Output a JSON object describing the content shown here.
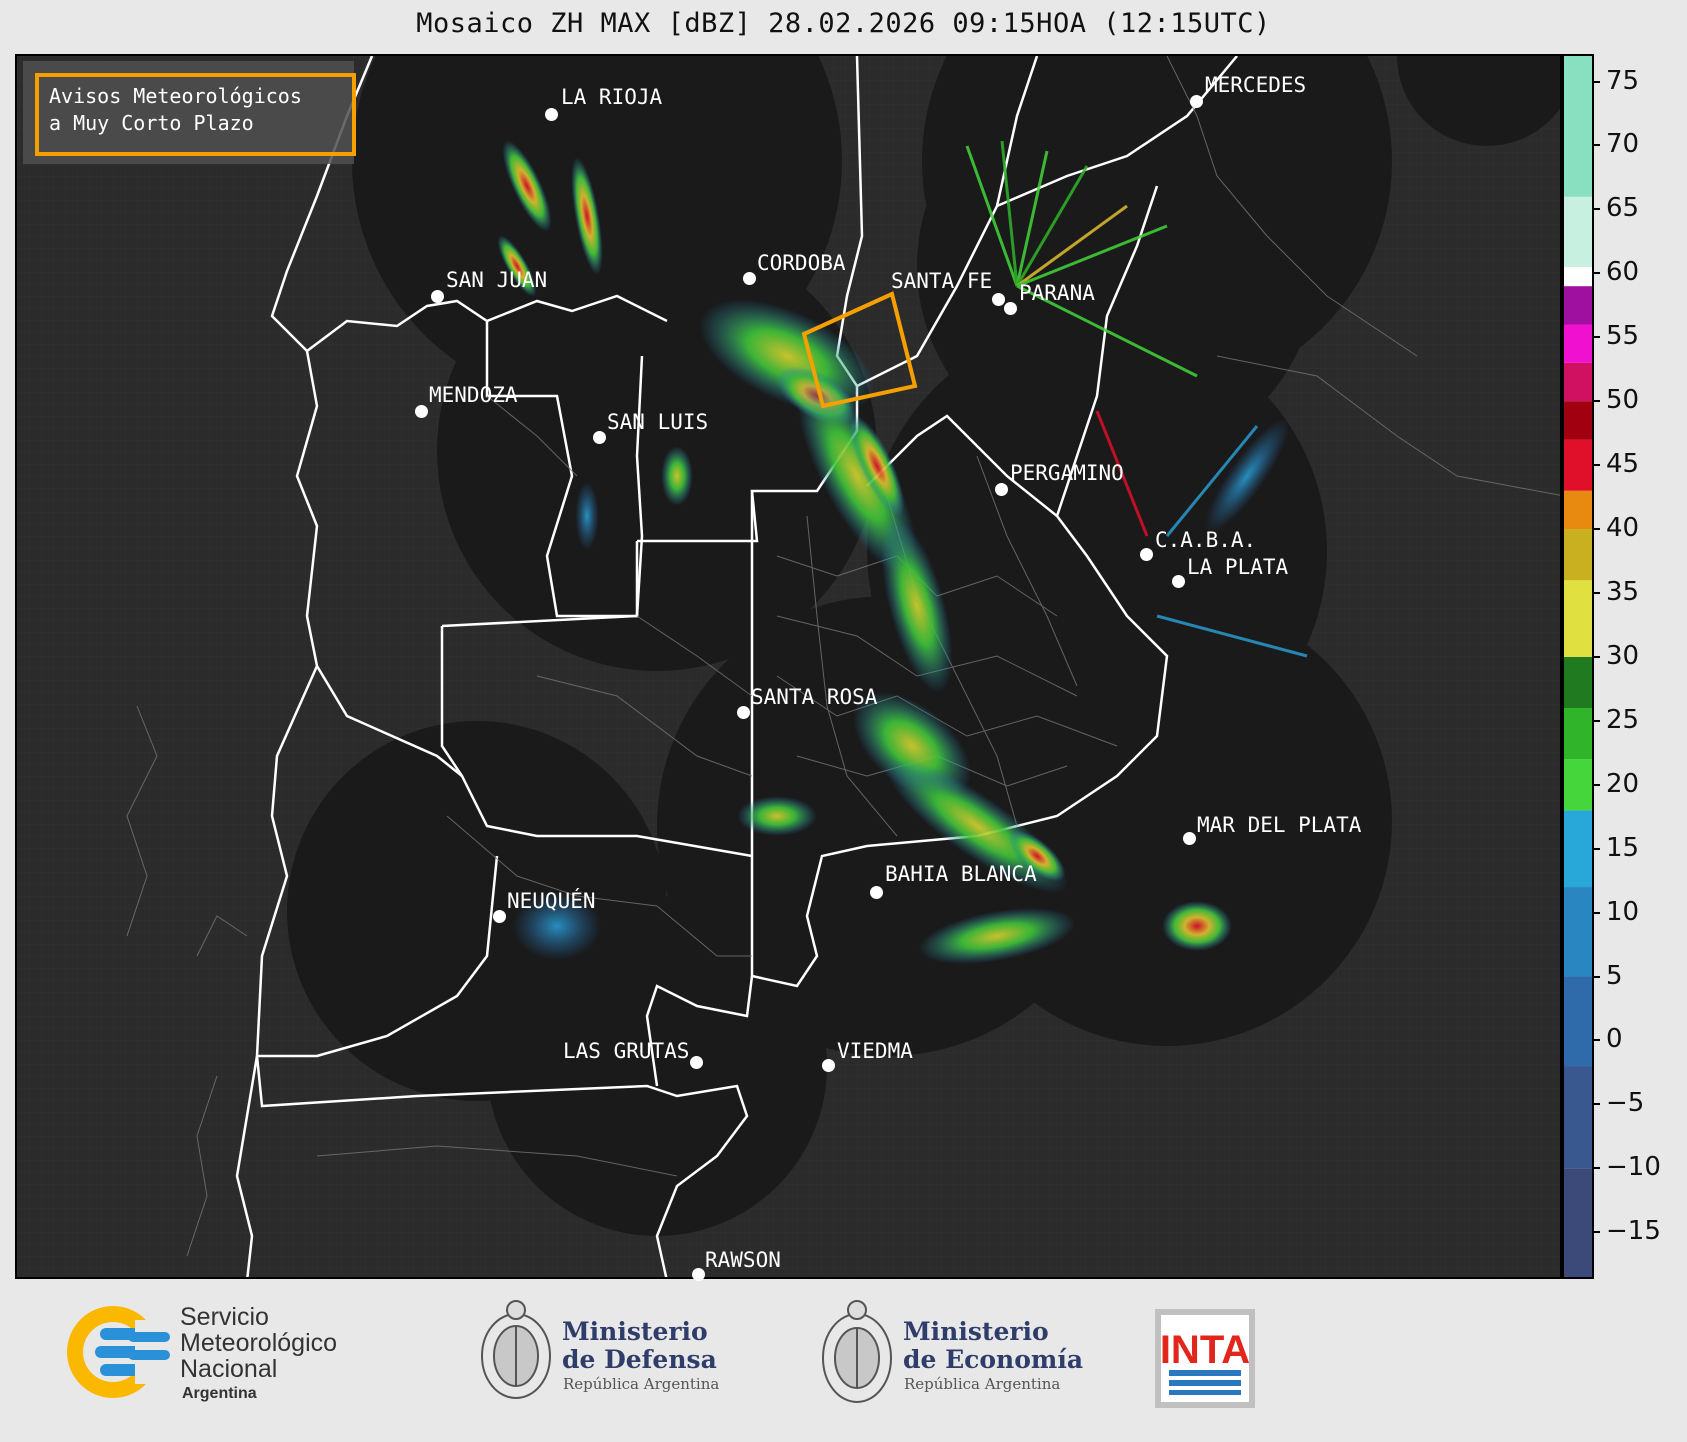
{
  "title": "Mosaico ZH MAX [dBZ] 28.02.2026 09:15HOA (12:15UTC)",
  "aviso": {
    "line1": "Avisos Meteorológicos",
    "line2": "a Muy Corto Plazo",
    "border_color": "#f5a000"
  },
  "cities": [
    {
      "name": "LA RIOJA",
      "key": "la-rioja"
    },
    {
      "name": "MERCEDES",
      "key": "mercedes"
    },
    {
      "name": "SAN JUAN",
      "key": "san-juan"
    },
    {
      "name": "CORDOBA",
      "key": "cordoba"
    },
    {
      "name": "SANTA FE",
      "key": "santa-fe"
    },
    {
      "name": "PARANA",
      "key": "parana"
    },
    {
      "name": "MENDOZA",
      "key": "mendoza"
    },
    {
      "name": "SAN LUIS",
      "key": "san-luis"
    },
    {
      "name": "PERGAMINO",
      "key": "pergamino"
    },
    {
      "name": "C.A.B.A.",
      "key": "caba"
    },
    {
      "name": "LA PLATA",
      "key": "la-plata"
    },
    {
      "name": "SANTA ROSA",
      "key": "santa-rosa"
    },
    {
      "name": "MAR DEL PLATA",
      "key": "mar-del-plata"
    },
    {
      "name": "BAHIA BLANCA",
      "key": "bahia-blanca"
    },
    {
      "name": "NEUQUÉN",
      "key": "neuquen"
    },
    {
      "name": "LAS GRUTAS",
      "key": "las-grutas"
    },
    {
      "name": "VIEDMA",
      "key": "viedma"
    },
    {
      "name": "RAWSON",
      "key": "rawson"
    }
  ],
  "colorbar": {
    "unit": "dBZ",
    "ticks": [
      "75",
      "70",
      "65",
      "60",
      "55",
      "50",
      "45",
      "40",
      "35",
      "30",
      "25",
      "20",
      "15",
      "10",
      "5",
      "0",
      "−5",
      "−10",
      "−15"
    ],
    "min": -18.5,
    "max": 77,
    "bands": [
      {
        "from": -18.5,
        "to": -10,
        "color": "#3c4a7a"
      },
      {
        "from": -10,
        "to": -2,
        "color": "#3a5890"
      },
      {
        "from": -2,
        "to": 5,
        "color": "#2f6aaa"
      },
      {
        "from": 5,
        "to": 12,
        "color": "#2a86c0"
      },
      {
        "from": 12,
        "to": 18,
        "color": "#28a8d8"
      },
      {
        "from": 18,
        "to": 22,
        "color": "#44d63a"
      },
      {
        "from": 22,
        "to": 26,
        "color": "#30b52a"
      },
      {
        "from": 26,
        "to": 30,
        "color": "#1f7a20"
      },
      {
        "from": 30,
        "to": 36,
        "color": "#e0e040"
      },
      {
        "from": 36,
        "to": 40,
        "color": "#c8b020"
      },
      {
        "from": 40,
        "to": 43,
        "color": "#e88a10"
      },
      {
        "from": 43,
        "to": 47,
        "color": "#e0102a"
      },
      {
        "from": 47,
        "to": 50,
        "color": "#a00010"
      },
      {
        "from": 50,
        "to": 53,
        "color": "#d01060"
      },
      {
        "from": 53,
        "to": 56,
        "color": "#f010d0"
      },
      {
        "from": 56,
        "to": 59,
        "color": "#a010a0"
      },
      {
        "from": 59,
        "to": 60.5,
        "color": "#ffffff"
      },
      {
        "from": 60.5,
        "to": 66,
        "color": "#c8f0e0"
      },
      {
        "from": 66,
        "to": 77,
        "color": "#88e0c0"
      }
    ]
  },
  "logos": {
    "smn": {
      "line1": "Servicio",
      "line2": "Meteorológico",
      "line3": "Nacional",
      "line4": "Argentina"
    },
    "defensa": {
      "line1": "Ministerio",
      "line2": "de Defensa",
      "line3": "República Argentina"
    },
    "economia": {
      "line1": "Ministerio",
      "line2": "de Economía",
      "line3": "República Argentina"
    },
    "inta": {
      "text": "INTA"
    }
  }
}
